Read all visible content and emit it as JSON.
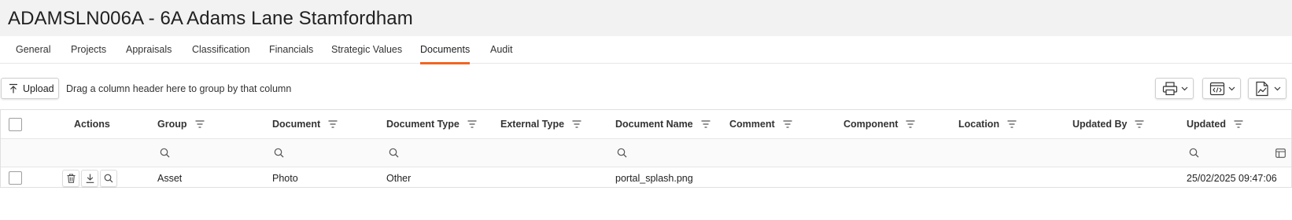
{
  "page": {
    "title": "ADAMSLN006A - 6A Adams Lane Stamfordham"
  },
  "tabs": [
    {
      "label": "General"
    },
    {
      "label": "Projects"
    },
    {
      "label": "Appraisals"
    },
    {
      "label": "Classification"
    },
    {
      "label": "Financials"
    },
    {
      "label": "Strategic Values"
    },
    {
      "label": "Documents",
      "active": true
    },
    {
      "label": "Audit"
    }
  ],
  "toolbar": {
    "upload_label": "Upload",
    "group_hint": "Drag a column header here to group by that column",
    "tools": [
      {
        "icon": "print-icon"
      },
      {
        "icon": "export-code-icon"
      },
      {
        "icon": "export-chart-icon"
      }
    ]
  },
  "grid": {
    "columns": [
      "Actions",
      "Group",
      "Document",
      "Document Type",
      "External Type",
      "Document Name",
      "Comment",
      "Component",
      "Location",
      "Updated By",
      "Updated"
    ],
    "rows": [
      {
        "group": "Asset",
        "document": "Photo",
        "document_type": "Other",
        "external_type": "",
        "document_name": "portal_splash.png",
        "comment": "",
        "component": "",
        "location": "",
        "updated_by": "",
        "updated": "25/02/2025 09:47:06"
      }
    ]
  },
  "colors": {
    "accent": "#f26522"
  }
}
